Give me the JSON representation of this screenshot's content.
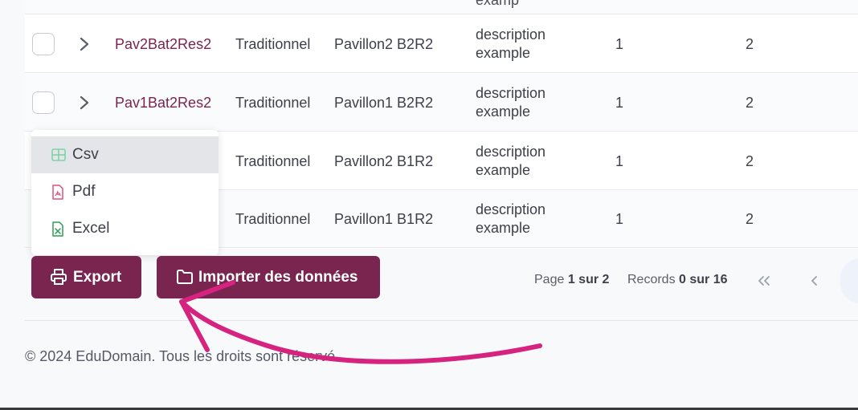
{
  "table": {
    "partial_top_text": "examp",
    "rows": [
      {
        "name": "Pav2Bat2Res2",
        "type": "Traditionnel",
        "pavillon": "Pavillon2 B2R2",
        "desc1": "description",
        "desc2": "example",
        "n1": "1",
        "n2": "2"
      },
      {
        "name": "Pav1Bat2Res2",
        "type": "Traditionnel",
        "pavillon": "Pavillon1 B2R2",
        "desc1": "description",
        "desc2": "example",
        "n1": "1",
        "n2": "2"
      },
      {
        "name": "",
        "type": "Traditionnel",
        "pavillon": "Pavillon2 B1R2",
        "desc1": "description",
        "desc2": "example",
        "n1": "1",
        "n2": "2"
      },
      {
        "name": "",
        "type": "Traditionnel",
        "pavillon": "Pavillon1 B1R2",
        "desc1": "description",
        "desc2": "example",
        "n1": "1",
        "n2": "2"
      }
    ]
  },
  "export_menu": {
    "items": [
      {
        "label": "Csv",
        "icon": "table-icon",
        "color": "#4caf7d"
      },
      {
        "label": "Pdf",
        "icon": "pdf-file-icon",
        "color": "#e0507a"
      },
      {
        "label": "Excel",
        "icon": "excel-file-icon",
        "color": "#2e9e52"
      }
    ]
  },
  "actions": {
    "export_label": "Export",
    "import_label": "Importer des données"
  },
  "pagination": {
    "page_prefix": "Page",
    "page_value": "1 sur 2",
    "records_prefix": "Records",
    "records_value": "0 sur 16",
    "first_icon": "double-chevron-left-icon",
    "prev_icon": "chevron-left-icon"
  },
  "footer": {
    "copyright": "© 2024 EduDomain. Tous les droits sont réservé"
  },
  "colors": {
    "brand": "#7a2450",
    "annotation_arrow": "#d6237f"
  }
}
